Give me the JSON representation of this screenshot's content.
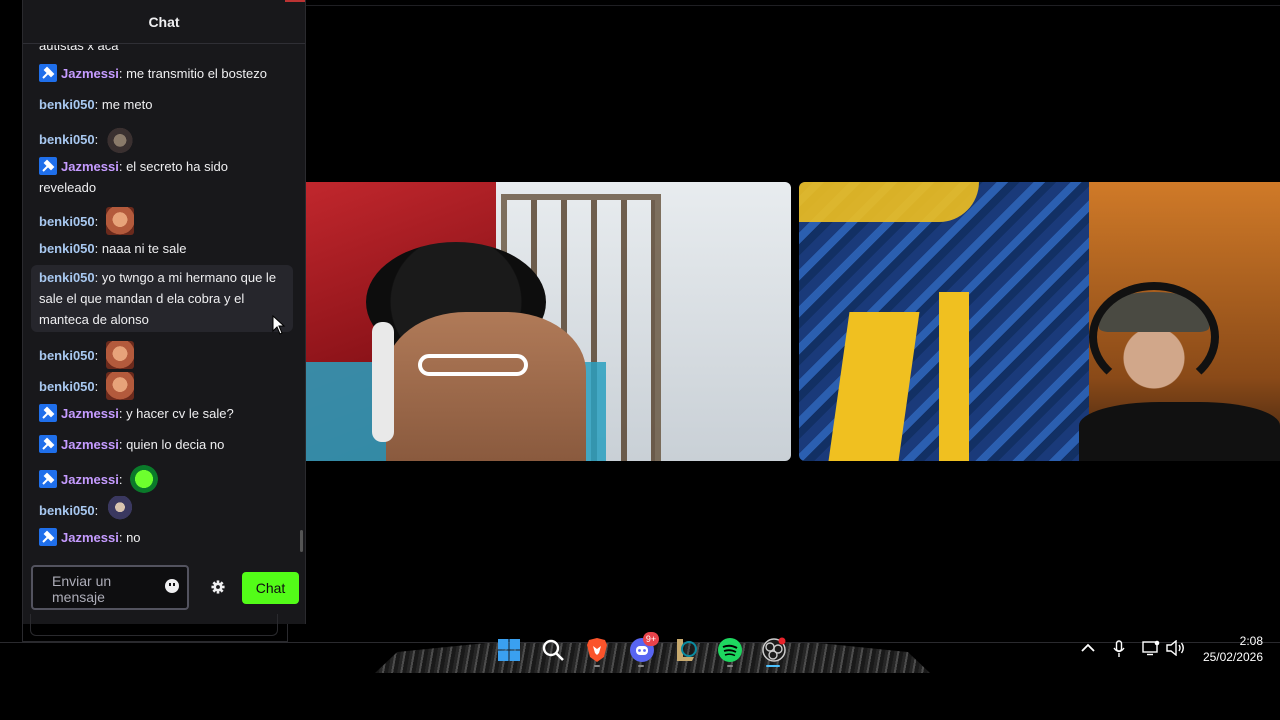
{
  "chat": {
    "title": "Chat",
    "messages": [
      {
        "user": "",
        "text": "autistas x aca",
        "badge": false
      },
      {
        "user": "Jazmessi",
        "text": "me transmitio el bostezo",
        "badge": true
      },
      {
        "user": "benki050",
        "text": "me meto",
        "badge": false
      },
      {
        "user": "benki050",
        "text": "",
        "emote": "moth-emote",
        "badge": false
      },
      {
        "user": "Jazmessi",
        "text": "el secreto ha sido reveleado",
        "badge": true
      },
      {
        "user": "benki050",
        "text": "",
        "emote": "face-emote",
        "badge": false
      },
      {
        "user": "benki050",
        "text": "naaa ni te sale",
        "badge": false
      },
      {
        "user": "benki050",
        "text": "yo twngo a mi hermano que le sale el que mandan d ela cobra y el manteca de alonso",
        "badge": false
      },
      {
        "user": "benki050",
        "text": "",
        "emote": "face-emote",
        "badge": false
      },
      {
        "user": "benki050",
        "text": "",
        "emote": "face-emote",
        "badge": false
      },
      {
        "user": "Jazmessi",
        "text": "y hacer cv le sale?",
        "badge": true
      },
      {
        "user": "Jazmessi",
        "text": "quien lo decia no",
        "badge": true
      },
      {
        "user": "Jazmessi",
        "text": "",
        "emote": "green-emote",
        "badge": true
      },
      {
        "user": "benki050",
        "text": "",
        "emote": "character-emote",
        "badge": false
      },
      {
        "user": "Jazmessi",
        "text": "no",
        "badge": true
      }
    ],
    "input_placeholder": "Enviar un mensaje",
    "send_label": "Chat"
  },
  "colors": {
    "user_jazmessi": "#c59bff",
    "user_benki": "#a8c8f0",
    "badge_blue": "#1f6feb",
    "chat_button": "#53fc18",
    "panel_bg": "#18181b"
  },
  "taskbar": {
    "icons": [
      "windows-start-icon",
      "search-icon",
      "brave-browser-icon",
      "discord-icon",
      "league-of-legends-icon",
      "spotify-icon",
      "obs-studio-icon"
    ],
    "discord_badge": "9+",
    "tray_icons": [
      "chevron-up-icon",
      "microphone-icon",
      "network-icon",
      "volume-icon"
    ],
    "time": "2:08",
    "date": "25/02/2026"
  }
}
